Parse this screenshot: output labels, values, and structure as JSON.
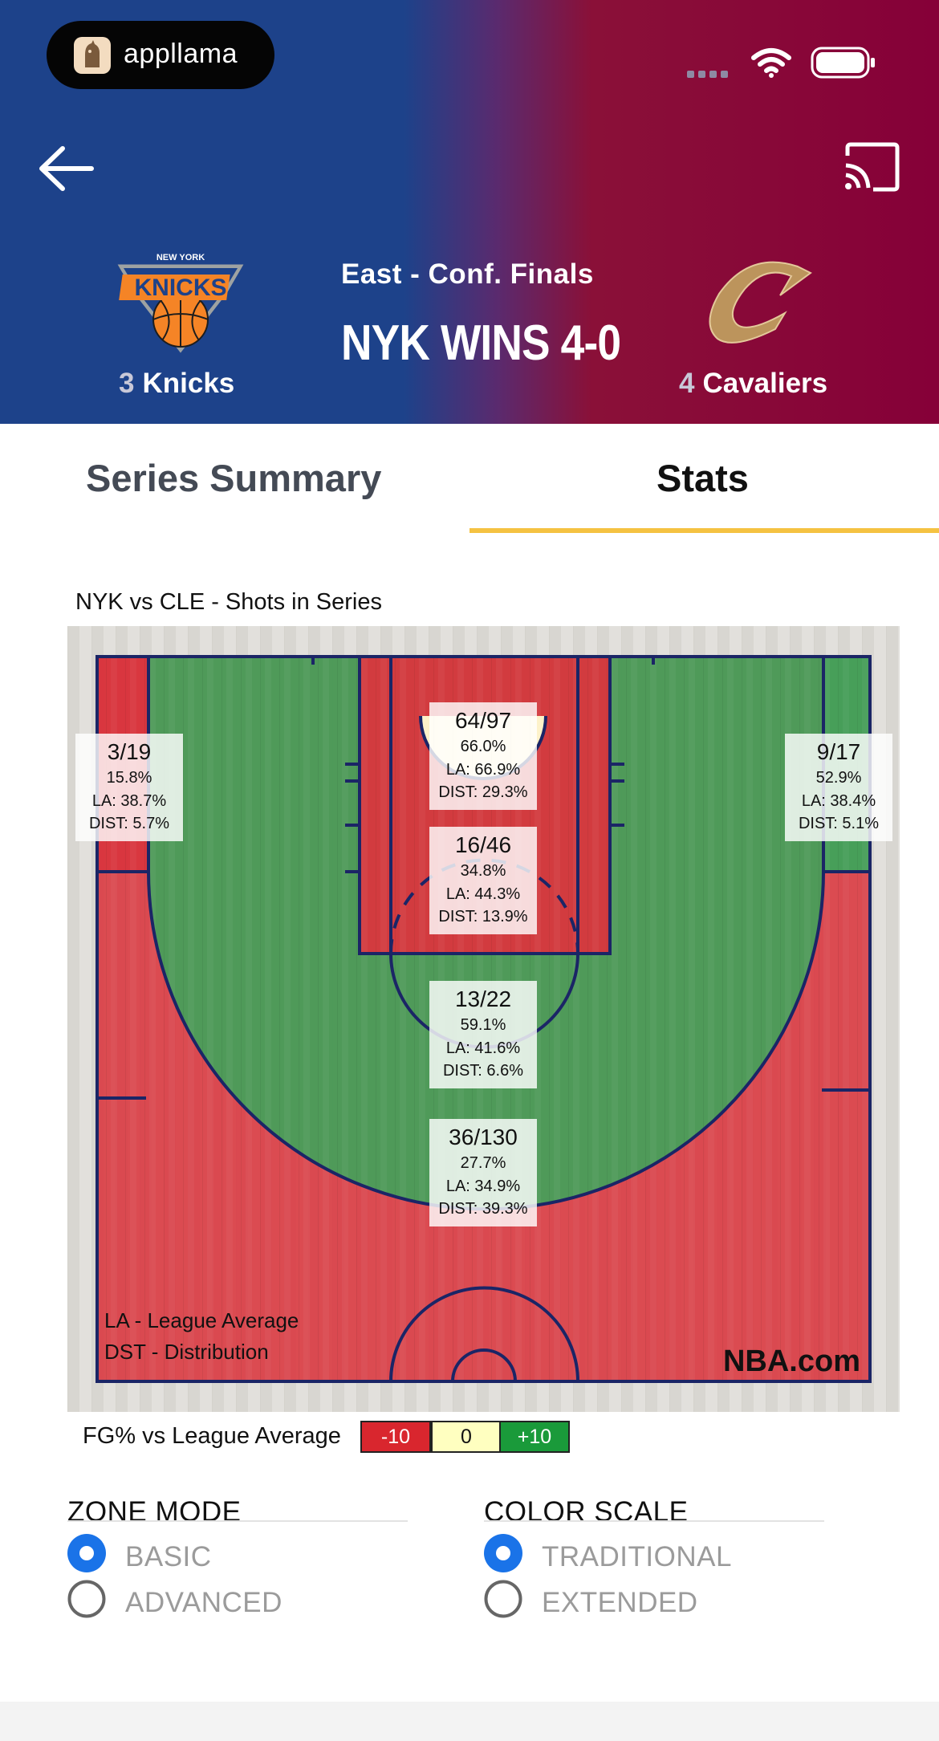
{
  "status_bar": {
    "app_badge": "appllama"
  },
  "header": {
    "series_round": "East - Conf. Finals",
    "series_result": "NYK WINS 4-0",
    "left_team": {
      "seed": "3",
      "name": "Knicks",
      "logo_text": "KNICKS",
      "logo_subtext": "NEW YORK"
    },
    "right_team": {
      "seed": "4",
      "name": "Cavaliers"
    }
  },
  "tabs": [
    {
      "label": "Series Summary",
      "selected": false
    },
    {
      "label": "Stats",
      "selected": true
    }
  ],
  "shot_chart": {
    "title": "NYK vs CLE - Shots in Series",
    "brand": "NBA.com",
    "notes": [
      "LA - League Average",
      "DST - Distribution"
    ],
    "zones": [
      {
        "id": "left-corner-three",
        "made_att": "3/19",
        "fg_pct": "15.8%",
        "la": "LA: 38.7%",
        "dist": "DIST: 5.7%"
      },
      {
        "id": "restricted-area",
        "made_att": "64/97",
        "fg_pct": "66.0%",
        "la": "LA: 66.9%",
        "dist": "DIST: 29.3%"
      },
      {
        "id": "right-corner-three",
        "made_att": "9/17",
        "fg_pct": "52.9%",
        "la": "LA: 38.4%",
        "dist": "DIST: 5.1%"
      },
      {
        "id": "paint-non-ra",
        "made_att": "16/46",
        "fg_pct": "34.8%",
        "la": "LA: 44.3%",
        "dist": "DIST: 13.9%"
      },
      {
        "id": "mid-range",
        "made_att": "13/22",
        "fg_pct": "59.1%",
        "la": "LA: 41.6%",
        "dist": "DIST: 6.6%"
      },
      {
        "id": "above-break-three",
        "made_att": "36/130",
        "fg_pct": "27.7%",
        "la": "LA: 34.9%",
        "dist": "DIST: 39.3%"
      }
    ],
    "legend": {
      "label": "FG% vs League Average",
      "items": [
        {
          "label": "-10",
          "color": "#d9262e"
        },
        {
          "label": "0",
          "color": "#ffffc0"
        },
        {
          "label": "+10",
          "color": "#1a9a3a"
        }
      ]
    }
  },
  "colors": {
    "knicks_blue": "#1d428a",
    "cavs_wine": "#860038",
    "tab_accent": "#f5c242",
    "zone_below": "#d9363e",
    "zone_above": "#3fa35a",
    "court_lines": "#1b2566",
    "radio_selected": "#1a73e8"
  },
  "options": {
    "zone_mode": {
      "title": "ZONE MODE",
      "options": [
        {
          "label": "BASIC",
          "selected": true
        },
        {
          "label": "ADVANCED",
          "selected": false
        }
      ]
    },
    "color_scale": {
      "title": "COLOR SCALE",
      "options": [
        {
          "label": "TRADITIONAL",
          "selected": true
        },
        {
          "label": "EXTENDED",
          "selected": false
        }
      ]
    }
  }
}
